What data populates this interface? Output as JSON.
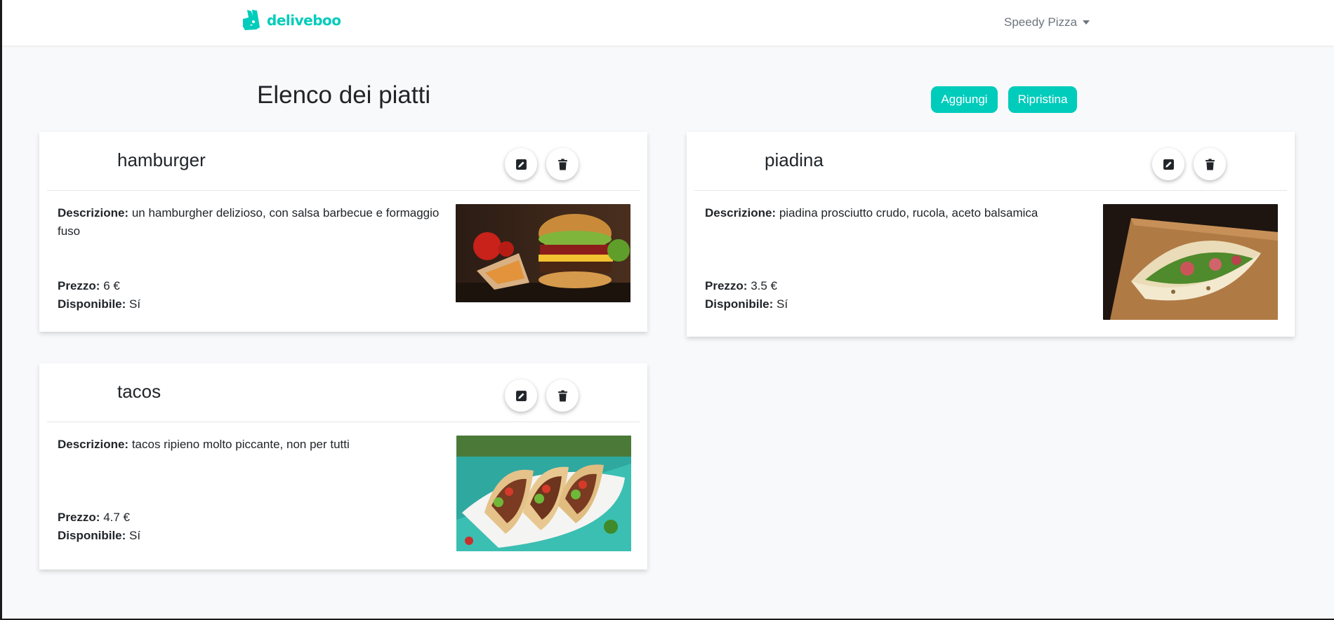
{
  "navbar": {
    "brand": "deliveboo",
    "user": "Speedy Pizza"
  },
  "page": {
    "title": "Elenco dei piatti",
    "add_label": "Aggiungi",
    "reset_label": "Ripristina"
  },
  "labels": {
    "description": "Descrizione:",
    "price": "Prezzo:",
    "available": "Disponibile:"
  },
  "dishes": [
    {
      "name": "hamburger",
      "description": "un hamburgher delizioso, con salsa barbecue e formaggio fuso",
      "price": "6 €",
      "available": "Sí"
    },
    {
      "name": "piadina",
      "description": "piadina prosciutto crudo, rucola, aceto balsamica",
      "price": "3.5 €",
      "available": "Sí"
    },
    {
      "name": "tacos",
      "description": "tacos ripieno molto piccante, non per tutti",
      "price": "4.7 €",
      "available": "Sí"
    }
  ],
  "icons": {
    "brand": "kangaroo-logo-icon",
    "edit": "pencil-square-icon",
    "delete": "trash-icon",
    "user_menu": "caret-down-icon"
  },
  "colors": {
    "accent": "#00ccbc",
    "background": "#f8f9fa"
  }
}
